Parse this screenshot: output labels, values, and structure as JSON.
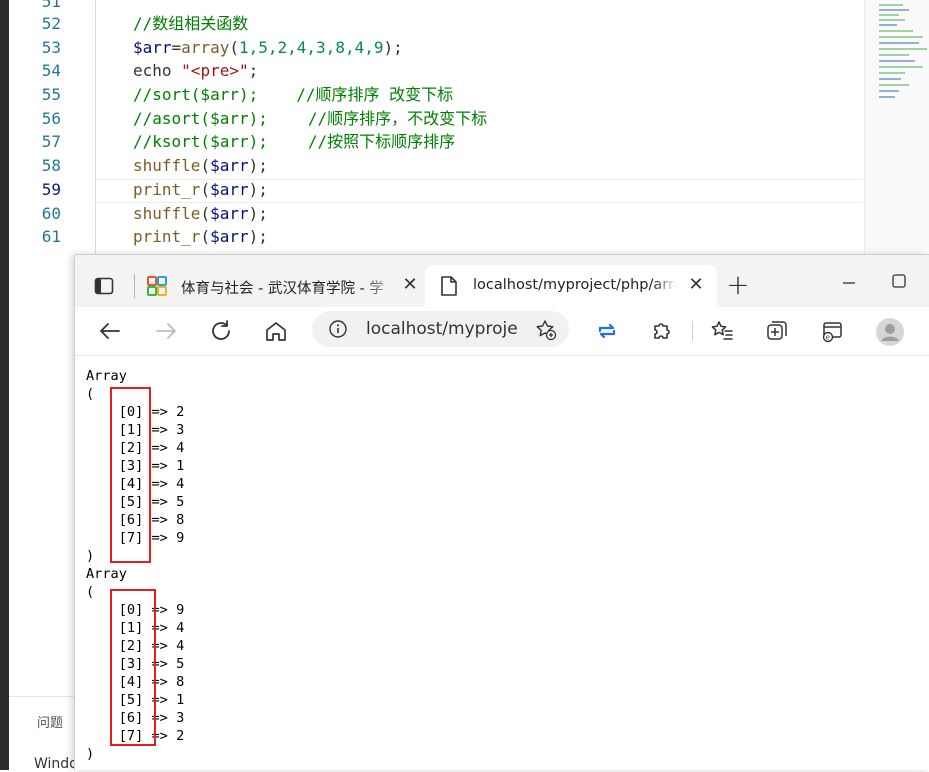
{
  "editor": {
    "line_numbers": [
      "51",
      "52",
      "53",
      "54",
      "55",
      "56",
      "57",
      "58",
      "59",
      "60",
      "61"
    ],
    "active_line": "59",
    "code": {
      "l52": "//数组相关函数",
      "l53_var": "$arr",
      "l53_eq": "=",
      "l53_fn": "array",
      "l53_open": "(",
      "l53_args": "1,5,2,4,3,8,4,9",
      "l53_close": ");",
      "l54_kw": "echo ",
      "l54_str": "\"<pre>\"",
      "l54_end": ";",
      "l55_code": "//sort($arr);",
      "l55_comment": "//顺序排序 改变下标",
      "l56_code": "//asort($arr);",
      "l56_comment": "//顺序排序，不改变下标",
      "l57_code": "//ksort($arr);",
      "l57_comment": "//按照下标顺序排序",
      "l58_fn": "shuffle",
      "l58_var": "$arr",
      "l59_fn": "print_r",
      "l59_var": "$arr",
      "l60_fn": "shuffle",
      "l60_var": "$arr",
      "l61_fn": "print_r",
      "l61_var": "$arr",
      "open_paren": "(",
      "close_stmt": ");"
    },
    "panel": {
      "problems_tab": "问题",
      "terminal_text": "Windo"
    }
  },
  "browser": {
    "tabs": [
      {
        "title": "体育与社会 - 武汉体育学院 - 学",
        "active": false,
        "favicon": "colorful-grid-icon"
      },
      {
        "title": "localhost/myproject/php/array.php",
        "active": true,
        "favicon": "page-icon"
      }
    ],
    "new_tab_label": "+",
    "address": "localhost/myproject/php/array.php",
    "toolbar_icons": [
      "back-icon",
      "forward-icon",
      "refresh-icon",
      "home-icon",
      "site-info-icon",
      "add-favorite-icon",
      "sync-icon",
      "extensions-icon",
      "favorites-icon",
      "collections-icon",
      "ie-mode-icon",
      "profile-icon"
    ],
    "accent_color": "#1a73e8"
  },
  "output": {
    "array1": {
      "header": "Array",
      "open": "(",
      "close": ")",
      "keys": [
        "[0]",
        "[1]",
        "[2]",
        "[3]",
        "[4]",
        "[5]",
        "[6]",
        "[7]"
      ],
      "arrow": "=>",
      "values": [
        "2",
        "3",
        "4",
        "1",
        "4",
        "5",
        "8",
        "9"
      ]
    },
    "array2": {
      "header": "Array",
      "open": "(",
      "close": ")",
      "keys": [
        "[0]",
        "[1]",
        "[2]",
        "[3]",
        "[4]",
        "[5]",
        "[6]",
        "[7]"
      ],
      "arrow": "=>",
      "values": [
        "9",
        "4",
        "4",
        "5",
        "8",
        "1",
        "3",
        "2"
      ]
    },
    "highlight_color": "#e01f1f"
  }
}
